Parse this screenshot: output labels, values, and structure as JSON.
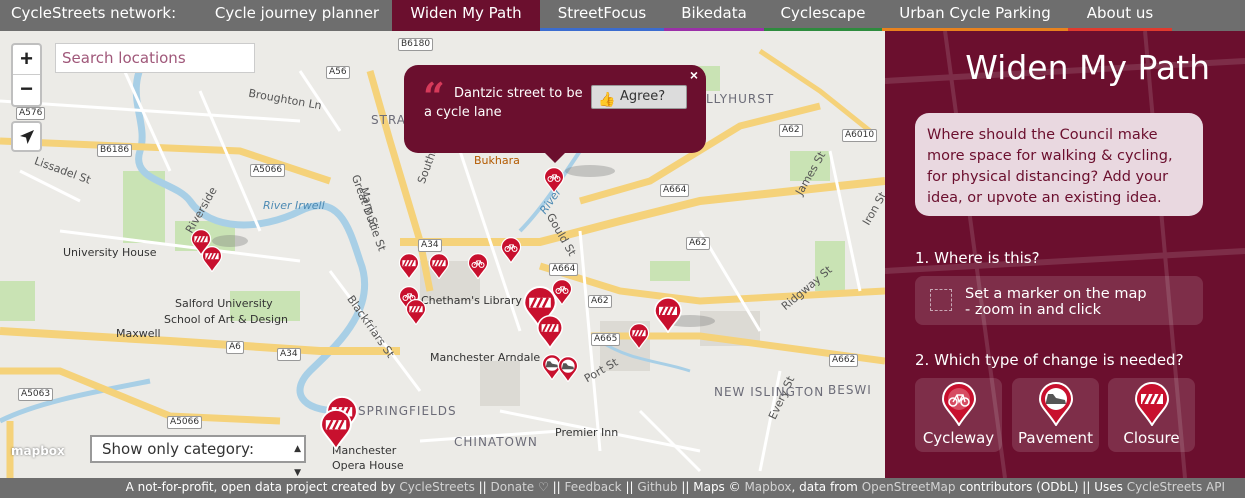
{
  "nav": {
    "brand": "CycleStreets network:",
    "items": [
      {
        "label": "Cycle journey planner",
        "stripe": "#6e6e6e"
      },
      {
        "label": "Widen My Path",
        "stripe": "#6b0f2e",
        "active": true
      },
      {
        "label": "StreetFocus",
        "stripe": "#3b6ccf"
      },
      {
        "label": "Bikedata",
        "stripe": "#9b30a8"
      },
      {
        "label": "Cyclescape",
        "stripe": "#2e8b3e"
      },
      {
        "label": "Urban Cycle Parking",
        "stripe": "#e8821e"
      },
      {
        "label": "About us",
        "stripe": "#e03a2e"
      }
    ]
  },
  "map": {
    "zoom_in": "+",
    "zoom_out": "−",
    "search_placeholder": "Search locations",
    "category_select": "Show only category:",
    "attribution_logo": "mapbox",
    "labels": {
      "broughton": "Broughton Ln",
      "lissadel": "Lissadel St",
      "greatducie": "Great Ducie St",
      "mary": "Mary St",
      "southall": "Southall St",
      "river_irwell": "River Irwell",
      "university_house": "University House",
      "salford_univ": "Salford University",
      "school_art": "School of Art & Design",
      "maxwell": "Maxwell",
      "blackfriars": "Blackfriars St",
      "chethams": "Chetham's Library",
      "arndale": "Manchester Arndale",
      "bukhara": "Bukhara",
      "gould": "Gould St",
      "james": "James St",
      "iron": "Iron St",
      "ridgway": "Ridgway St",
      "everyst": "Every St",
      "newislington": "NEW ISLINGTON",
      "chinatown": "CHINATOWN",
      "premier": "Premier Inn",
      "springfields": "SPRINGFIELDS",
      "opera": "Manchester",
      "opera2": "Opera House",
      "port": "Port St",
      "stra": "STRA",
      "beswi": "BESWI",
      "llyhurst": "LLYHURST",
      "river_short": "River",
      "riverside": "Riverside"
    },
    "roads": [
      "B6180",
      "A56",
      "A576",
      "B6186",
      "A5066",
      "A34",
      "A664",
      "A62",
      "A6010",
      "A62",
      "A664",
      "A62",
      "A665",
      "A6",
      "A34",
      "A5063",
      "A5066",
      "A662"
    ]
  },
  "popup": {
    "text": "Dantzic street to be a cycle lane",
    "agree": "Agree?",
    "close": "×"
  },
  "panel": {
    "title": "Widen My Path",
    "intro": "Where should the Council make more space for walking & cycling, for physical distancing? Add your idea, or upvote an existing idea.",
    "step1": "1. Where is this?",
    "marker_line1": "Set a marker on the map",
    "marker_line2": "- zoom in and click",
    "step2": "2. Which type of change is needed?",
    "categories": [
      {
        "label": "Cycleway",
        "icon": "bicycle-icon"
      },
      {
        "label": "Pavement",
        "icon": "shoe-icon"
      },
      {
        "label": "Closure",
        "icon": "barrier-icon"
      }
    ]
  },
  "footer": {
    "text1": "A not-for-profit, open data project created by ",
    "cyclestreets": "CycleStreets",
    "sep": " || ",
    "donate": "Donate ♡",
    "feedback": "Feedback",
    "github": "Github",
    "maps": "Maps © ",
    "mapbox": "Mapbox",
    "data_from": ", data from ",
    "osm": "OpenStreetMap",
    "contrib": " contributors (ODbL) || Uses ",
    "api": "CycleStreets API"
  },
  "colors": {
    "brand": "#6b0f2e",
    "accent_red": "#c8102e",
    "nav_bg": "#6e6e6e"
  }
}
